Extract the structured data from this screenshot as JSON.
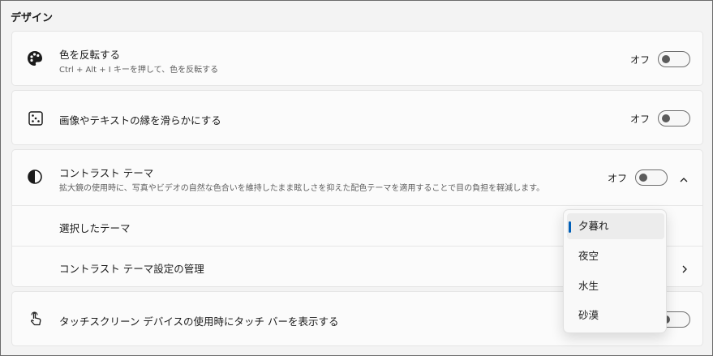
{
  "section": {
    "title": "デザイン"
  },
  "invert_colors": {
    "title": "色を反転する",
    "subtitle": "Ctrl + Alt + I キーを押して、色を反転する",
    "state": "オフ",
    "icon": "palette-icon"
  },
  "smooth_edges": {
    "title": "画像やテキストの縁を滑らかにする",
    "state": "オフ",
    "icon": "dice-icon"
  },
  "contrast_theme": {
    "title": "コントラスト テーマ",
    "subtitle": "拡大鏡の使用時に、写真やビデオの自然な色合いを維持したまま眩しさを抑えた配色テーマを適用することで目の負担を軽減します。",
    "state": "オフ",
    "icon": "contrast-icon",
    "selected_theme_label": "選択したテーマ",
    "manage_label": "コントラスト テーマ設定の管理"
  },
  "touch_bar": {
    "title": "タッチスクリーン デバイスの使用時にタッチ バーを表示する",
    "icon": "touch-hand-icon"
  },
  "theme_dropdown": {
    "options": [
      "夕暮れ",
      "夜空",
      "水生",
      "砂漠"
    ],
    "selected": "夕暮れ",
    "accent_color": "#005fb8"
  }
}
